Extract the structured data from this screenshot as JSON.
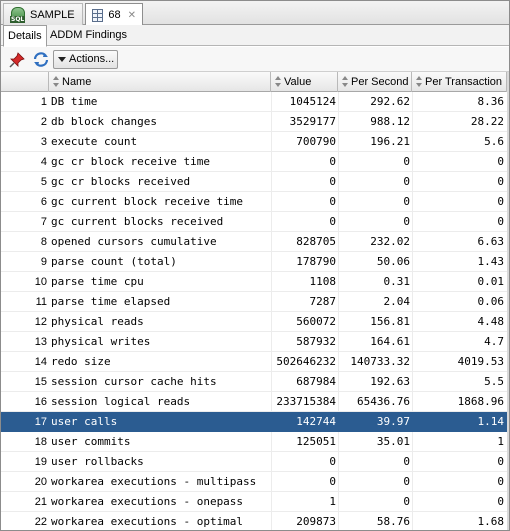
{
  "tabs": [
    {
      "label": "SAMPLE",
      "icon": "sql-database-icon"
    },
    {
      "label": "68",
      "icon": "grid-icon"
    }
  ],
  "subtabs": [
    "Details",
    "ADDM Findings"
  ],
  "toolbar": {
    "actions_label": "Actions..."
  },
  "columns": [
    "",
    "Name",
    "Value",
    "Per Second",
    "Per Transaction"
  ],
  "selected_row": 17,
  "colors": {
    "selection": "#2b5c91"
  },
  "rows": [
    {
      "n": "1",
      "name": "DB time",
      "value": "1045124",
      "per_second": "292.62",
      "per_txn": "8.36"
    },
    {
      "n": "2",
      "name": "db block changes",
      "value": "3529177",
      "per_second": "988.12",
      "per_txn": "28.22"
    },
    {
      "n": "3",
      "name": "execute count",
      "value": "700790",
      "per_second": "196.21",
      "per_txn": "5.6"
    },
    {
      "n": "4",
      "name": "gc cr block receive time",
      "value": "0",
      "per_second": "0",
      "per_txn": "0"
    },
    {
      "n": "5",
      "name": "gc cr blocks received",
      "value": "0",
      "per_second": "0",
      "per_txn": "0"
    },
    {
      "n": "6",
      "name": "gc current block receive time",
      "value": "0",
      "per_second": "0",
      "per_txn": "0"
    },
    {
      "n": "7",
      "name": "gc current blocks received",
      "value": "0",
      "per_second": "0",
      "per_txn": "0"
    },
    {
      "n": "8",
      "name": "opened cursors cumulative",
      "value": "828705",
      "per_second": "232.02",
      "per_txn": "6.63"
    },
    {
      "n": "9",
      "name": "parse count (total)",
      "value": "178790",
      "per_second": "50.06",
      "per_txn": "1.43"
    },
    {
      "n": "10",
      "name": "parse time cpu",
      "value": "1108",
      "per_second": "0.31",
      "per_txn": "0.01"
    },
    {
      "n": "11",
      "name": "parse time elapsed",
      "value": "7287",
      "per_second": "2.04",
      "per_txn": "0.06"
    },
    {
      "n": "12",
      "name": "physical reads",
      "value": "560072",
      "per_second": "156.81",
      "per_txn": "4.48"
    },
    {
      "n": "13",
      "name": "physical writes",
      "value": "587932",
      "per_second": "164.61",
      "per_txn": "4.7"
    },
    {
      "n": "14",
      "name": "redo size",
      "value": "502646232",
      "per_second": "140733.32",
      "per_txn": "4019.53"
    },
    {
      "n": "15",
      "name": "session cursor cache hits",
      "value": "687984",
      "per_second": "192.63",
      "per_txn": "5.5"
    },
    {
      "n": "16",
      "name": "session logical reads",
      "value": "233715384",
      "per_second": "65436.76",
      "per_txn": "1868.96"
    },
    {
      "n": "17",
      "name": "user calls",
      "value": "142744",
      "per_second": "39.97",
      "per_txn": "1.14"
    },
    {
      "n": "18",
      "name": "user commits",
      "value": "125051",
      "per_second": "35.01",
      "per_txn": "1"
    },
    {
      "n": "19",
      "name": "user rollbacks",
      "value": "0",
      "per_second": "0",
      "per_txn": "0"
    },
    {
      "n": "20",
      "name": "workarea executions - multipass",
      "value": "0",
      "per_second": "0",
      "per_txn": "0"
    },
    {
      "n": "21",
      "name": "workarea executions - onepass",
      "value": "1",
      "per_second": "0",
      "per_txn": "0"
    },
    {
      "n": "22",
      "name": "workarea executions - optimal",
      "value": "209873",
      "per_second": "58.76",
      "per_txn": "1.68"
    }
  ]
}
